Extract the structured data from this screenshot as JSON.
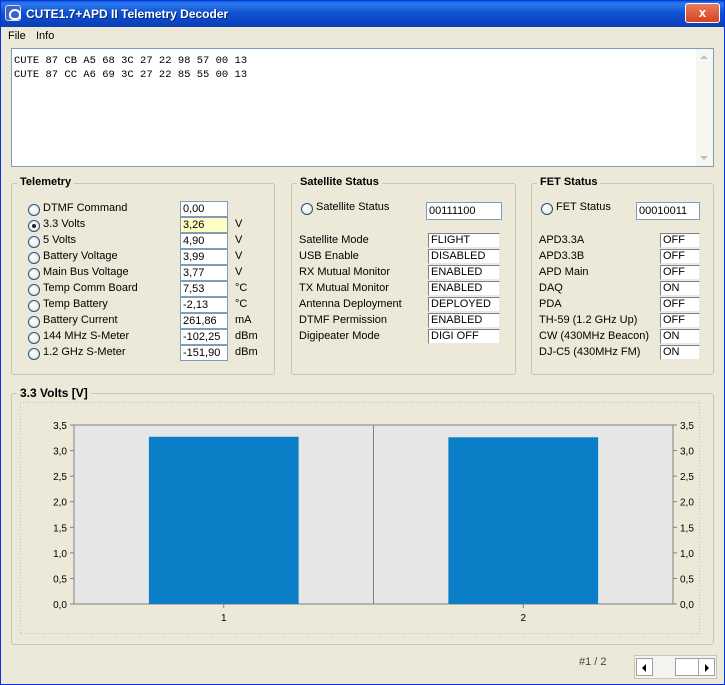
{
  "window": {
    "title": "CUTE1.7+APD II Telemetry Decoder",
    "close_label": "x"
  },
  "menu": [
    "File",
    "Info"
  ],
  "raw_frames": [
    "CUTE 87 CB A5 68 3C 27 22 98 57 00 13",
    "CUTE 87 CC A6 69 3C 27 22 85 55 00 13"
  ],
  "telemetry": {
    "title": "Telemetry",
    "rows": [
      {
        "label": "DTMF Command",
        "value": "0,00",
        "unit": "",
        "selected": false
      },
      {
        "label": "3.3 Volts",
        "value": "3,26",
        "unit": "V",
        "selected": true
      },
      {
        "label": "5 Volts",
        "value": "4,90",
        "unit": "V",
        "selected": false
      },
      {
        "label": "Battery Voltage",
        "value": "3,99",
        "unit": "V",
        "selected": false
      },
      {
        "label": "Main Bus Voltage",
        "value": "3,77",
        "unit": "V",
        "selected": false
      },
      {
        "label": "Temp Comm Board",
        "value": "7,53",
        "unit": "°C",
        "selected": false
      },
      {
        "label": "Temp Battery",
        "value": "-2,13",
        "unit": "°C",
        "selected": false
      },
      {
        "label": "Battery Current",
        "value": "261,86",
        "unit": "mA",
        "selected": false
      },
      {
        "label": "144 MHz S-Meter",
        "value": "-102,25",
        "unit": "dBm",
        "selected": false
      },
      {
        "label": "1.2 GHz S-Meter",
        "value": "-151,90",
        "unit": "dBm",
        "selected": false
      }
    ]
  },
  "satellite": {
    "title": "Satellite Status",
    "radio_label": "Satellite Status",
    "value": "00111100",
    "rows": [
      {
        "label": "Satellite Mode",
        "value": "FLIGHT"
      },
      {
        "label": "USB Enable",
        "value": "DISABLED"
      },
      {
        "label": "RX Mutual Monitor",
        "value": "ENABLED"
      },
      {
        "label": "TX Mutual Monitor",
        "value": "ENABLED"
      },
      {
        "label": "Antenna Deployment",
        "value": "DEPLOYED"
      },
      {
        "label": "DTMF Permission",
        "value": "ENABLED"
      },
      {
        "label": "Digipeater Mode",
        "value": "DIGI OFF"
      }
    ]
  },
  "fet": {
    "title": "FET Status",
    "radio_label": "FET Status",
    "value": "00010011",
    "rows": [
      {
        "label": "APD3.3A",
        "value": "OFF"
      },
      {
        "label": "APD3.3B",
        "value": "OFF"
      },
      {
        "label": "APD Main",
        "value": "OFF"
      },
      {
        "label": "DAQ",
        "value": "ON"
      },
      {
        "label": "PDA",
        "value": "OFF"
      },
      {
        "label": "TH-59 (1.2 GHz Up)",
        "value": "OFF"
      },
      {
        "label": "CW (430MHz Beacon)",
        "value": "ON"
      },
      {
        "label": "DJ-C5 (430MHz FM)",
        "value": "ON"
      }
    ]
  },
  "chart_data": {
    "type": "bar",
    "title": "3.3 Volts [V]",
    "categories": [
      "1",
      "2"
    ],
    "values": [
      3.27,
      3.26
    ],
    "ylim": [
      0,
      3.5
    ],
    "yticks": [
      "0,0",
      "0,5",
      "1,0",
      "1,5",
      "2,0",
      "2,5",
      "3,0",
      "3,5"
    ],
    "bar_color": "#0a7fc8",
    "grid": true
  },
  "footer": {
    "page_label": "#1 / 2"
  }
}
